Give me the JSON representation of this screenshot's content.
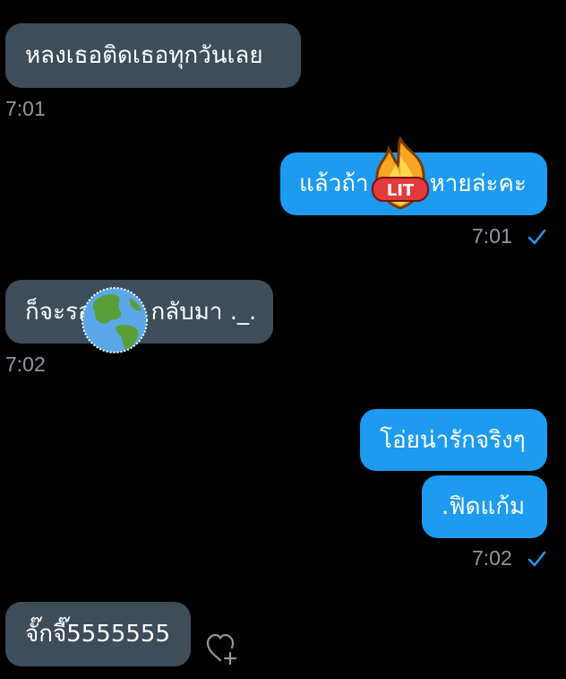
{
  "conversation": {
    "messages": [
      {
        "direction": "incoming",
        "text": "หลงเธอติดเธอทุกวันเลย",
        "time": "7:01"
      },
      {
        "direction": "outgoing",
        "text": "แล้วถ้า หายล่ะคะ",
        "text_before": "แล้วถ้า",
        "text_after": "หายล่ะคะ",
        "time": "7:01",
        "sticker": {
          "name": "lit-fire-sticker",
          "label": "LIT"
        }
      },
      {
        "direction": "incoming",
        "text_before": "ก็จะรอ",
        "text_after": "กลับมา ._.",
        "time": "7:02",
        "sticker": {
          "name": "globe-sticker"
        }
      },
      {
        "direction": "outgoing",
        "text": "โอ่ยน่ารักจริงๆ"
      },
      {
        "direction": "outgoing",
        "text": ".ฟิดแก้ม",
        "time": "7:02"
      },
      {
        "direction": "incoming",
        "text": "จั๊กจี๊5555555"
      }
    ],
    "read_receipt_icon": "checkmark-icon",
    "like_icon": "heart-plus-icon"
  },
  "colors": {
    "background": "#000000",
    "incoming_bubble": "#3d4d5a",
    "outgoing_bubble": "#1d9bf0",
    "timestamp": "#8b98a5",
    "checkmark": "#1d9bf0"
  }
}
